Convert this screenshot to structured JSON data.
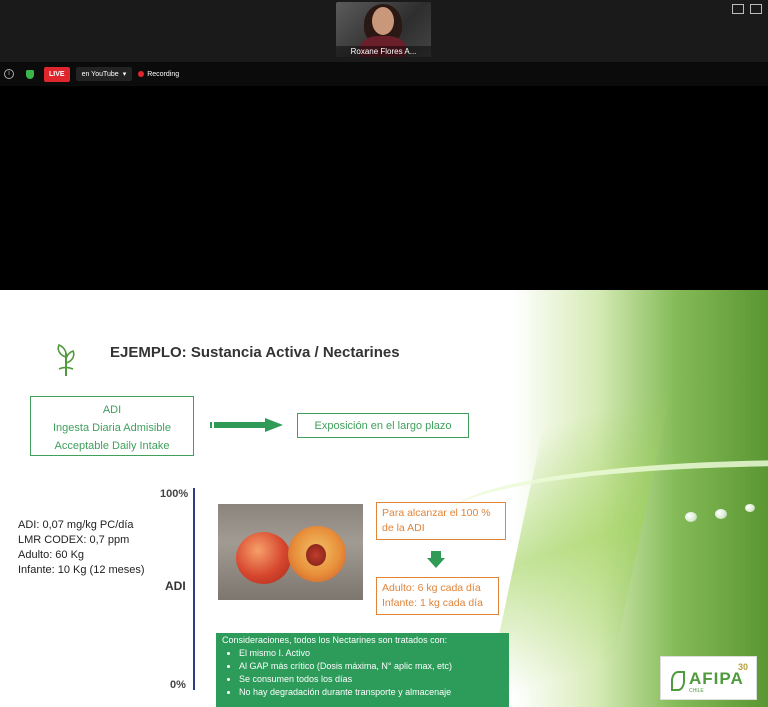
{
  "participant": {
    "name": "Roxane Flores A..."
  },
  "status": {
    "live_label": "LIVE",
    "youtube_label": "en YouTube",
    "recording_label": "Recording"
  },
  "slide": {
    "title": "EJEMPLO: Sustancia Activa / Nectarines",
    "adi_box": [
      "ADI",
      "Ingesta Diaria Admisible",
      "Acceptable Daily Intake"
    ],
    "exposure_box": "Exposición en el largo plazo",
    "axis": {
      "top": "100%",
      "bottom": "0%",
      "label": "ADI"
    },
    "facts": [
      "ADI: 0,07 mg/kg PC/día",
      "LMR CODEX: 0,7 ppm",
      "Adulto: 60 Kg",
      "Infante: 10 Kg (12 meses)"
    ],
    "orange_box_1": [
      "Para alcanzar el 100 %",
      "de la ADI"
    ],
    "orange_box_2": [
      "Adulto: 6 kg cada día",
      "Infante: 1 kg cada día"
    ],
    "considerations": {
      "heading": "Consideraciones, todos los Nectarines son tratados con:",
      "items": [
        "El mismo I. Activo",
        "Al GAP más crítico (Dosis máxima, N° aplic max, etc)",
        "Se consumen todos los días",
        "No hay degradación durante transporte y almacenaje"
      ]
    },
    "logo": {
      "word": "AFIPA",
      "sub": "CHILE",
      "number": "30"
    }
  }
}
